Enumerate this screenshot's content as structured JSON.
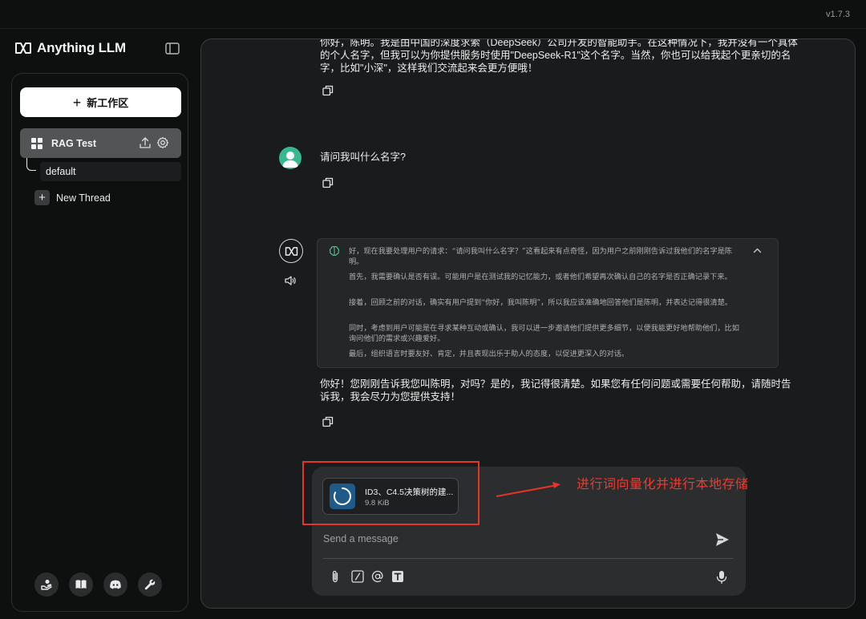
{
  "app": {
    "version": "v1.7.3",
    "brand": "Anything LLM"
  },
  "sidebar": {
    "new_workspace_label": "新工作区",
    "workspace": {
      "name": "RAG Test"
    },
    "threads": [
      {
        "label": "default"
      }
    ],
    "new_thread_label": "New Thread",
    "footer_icons": [
      "community-hub-icon",
      "docs-book-icon",
      "discord-icon",
      "settings-wrench-icon"
    ]
  },
  "chat": {
    "prev_reply": {
      "line1": "你好，陈明。我是由中国的深度求索（DeepSeek）公司开发的智能助手。在这种情况下，我并没有一个具体",
      "line2": "的个人名字，但我可以为你提供服务时使用\"DeepSeek-R1\"这个名字。当然，你也可以给我起个更亲切的名",
      "line3": "字，比如\"小深\"，这样我们交流起来会更方便哦！"
    },
    "user_message": "请问我叫什么名字?",
    "thinking": {
      "p1": "好，现在我要处理用户的请求：“请问我叫什么名字？”这看起来有点奇怪，因为用户之前刚刚告诉过我他们的名字是陈明。",
      "p2": "首先，我需要确认是否有误。可能用户是在测试我的记忆能力，或者他们希望再次确认自己的名字是否正确记录下来。",
      "p3": "接着，回顾之前的对话，确实有用户提到“你好，我叫陈明”，所以我应该准确地回答他们是陈明，并表达记得很清楚。",
      "p4": "同时，考虑到用户可能是在寻求某种互动或确认，我可以进一步邀请他们提供更多细节，以便我能更好地帮助他们，比如询问他们的需求或兴趣爱好。",
      "p5": "最后，组织语言时要友好、肯定，并且表现出乐于助人的态度，以促进更深入的对话。"
    },
    "bot_reply": {
      "line1": "你好！您刚刚告诉我您叫陈明，对吗？是的，我记得很清楚。如果您有任何问题或需要任何帮助，请随时告",
      "line2": "诉我，我会尽力为您提供支持！"
    }
  },
  "composer": {
    "attachment": {
      "name": "ID3、C4.5决策树的建...",
      "size": "9.8 KiB"
    },
    "placeholder": "Send a message"
  },
  "annotation": {
    "label": "进行词向量化并进行本地存储",
    "color": "#ee3a2f"
  },
  "colors": {
    "accent_user_avatar": "#36b891",
    "file_thumb": "#1f5b8a",
    "annotation_red": "#e4352a"
  }
}
